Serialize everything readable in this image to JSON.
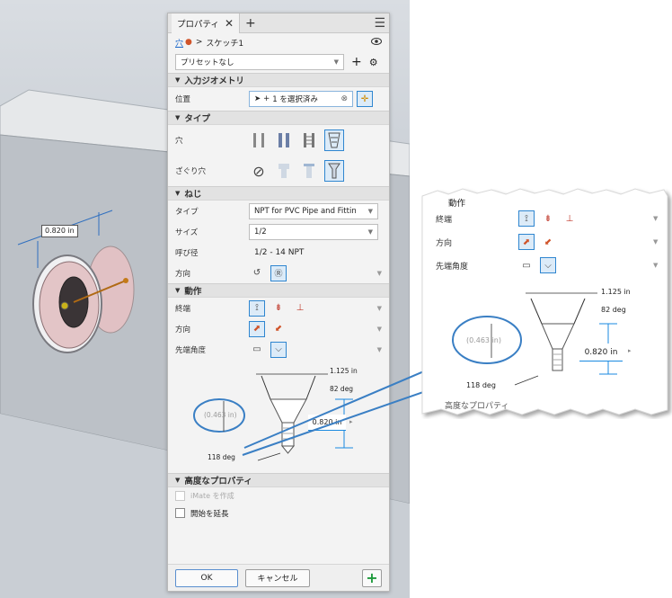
{
  "viewport": {
    "dimension_label": "0.820 in"
  },
  "panel": {
    "tab_title": "プロパティ",
    "breadcrumb": {
      "feature": "穴",
      "separator": ">",
      "sketch": "スケッチ1"
    },
    "preset": {
      "value": "プリセットなし"
    },
    "sections": {
      "input_geometry": "入力ジオメトリ",
      "type": "タイプ",
      "thread": "ねじ",
      "behavior": "動作",
      "advanced": "高度なプロパティ"
    },
    "input_geometry": {
      "position_label": "位置",
      "selection_text": "1 を選択済み"
    },
    "type": {
      "hole_label": "穴",
      "seat_label": "ざぐり穴"
    },
    "thread": {
      "type_label": "タイプ",
      "type_value": "NPT for PVC Pipe and Fittin",
      "size_label": "サイズ",
      "size_value": "1/2",
      "designation_label": "呼び径",
      "designation_value": "1/2 - 14 NPT",
      "direction_label": "方向"
    },
    "behavior": {
      "termination_label": "終端",
      "direction_label": "方向",
      "tip_angle_label": "先端角度",
      "diagram": {
        "top_width": "1.125 in",
        "csk_angle": "82 deg",
        "depth_ref": "(0.463 in)",
        "depth_value": "0.820 in",
        "tip_angle": "118 deg"
      }
    },
    "advanced": {
      "imate_label": "iMate を作成",
      "extend_label": "開始を延長"
    },
    "buttons": {
      "ok": "OK",
      "cancel": "キャンセル"
    }
  },
  "callout": {
    "header": "動作",
    "termination_label": "終端",
    "direction_label": "方向",
    "tip_angle_label": "先端角度",
    "top_width": "1.125 in",
    "csk_angle": "82 deg",
    "depth_ref": "(0.463 in)",
    "depth_value": "0.820 in",
    "tip_angle": "118 deg",
    "footer": "高度なプロパティ"
  },
  "colors": {
    "accent": "#2f86d0",
    "link": "#1a66c9",
    "add_green": "#1e9a3c",
    "highlight_ring": "#3a7fc4"
  }
}
